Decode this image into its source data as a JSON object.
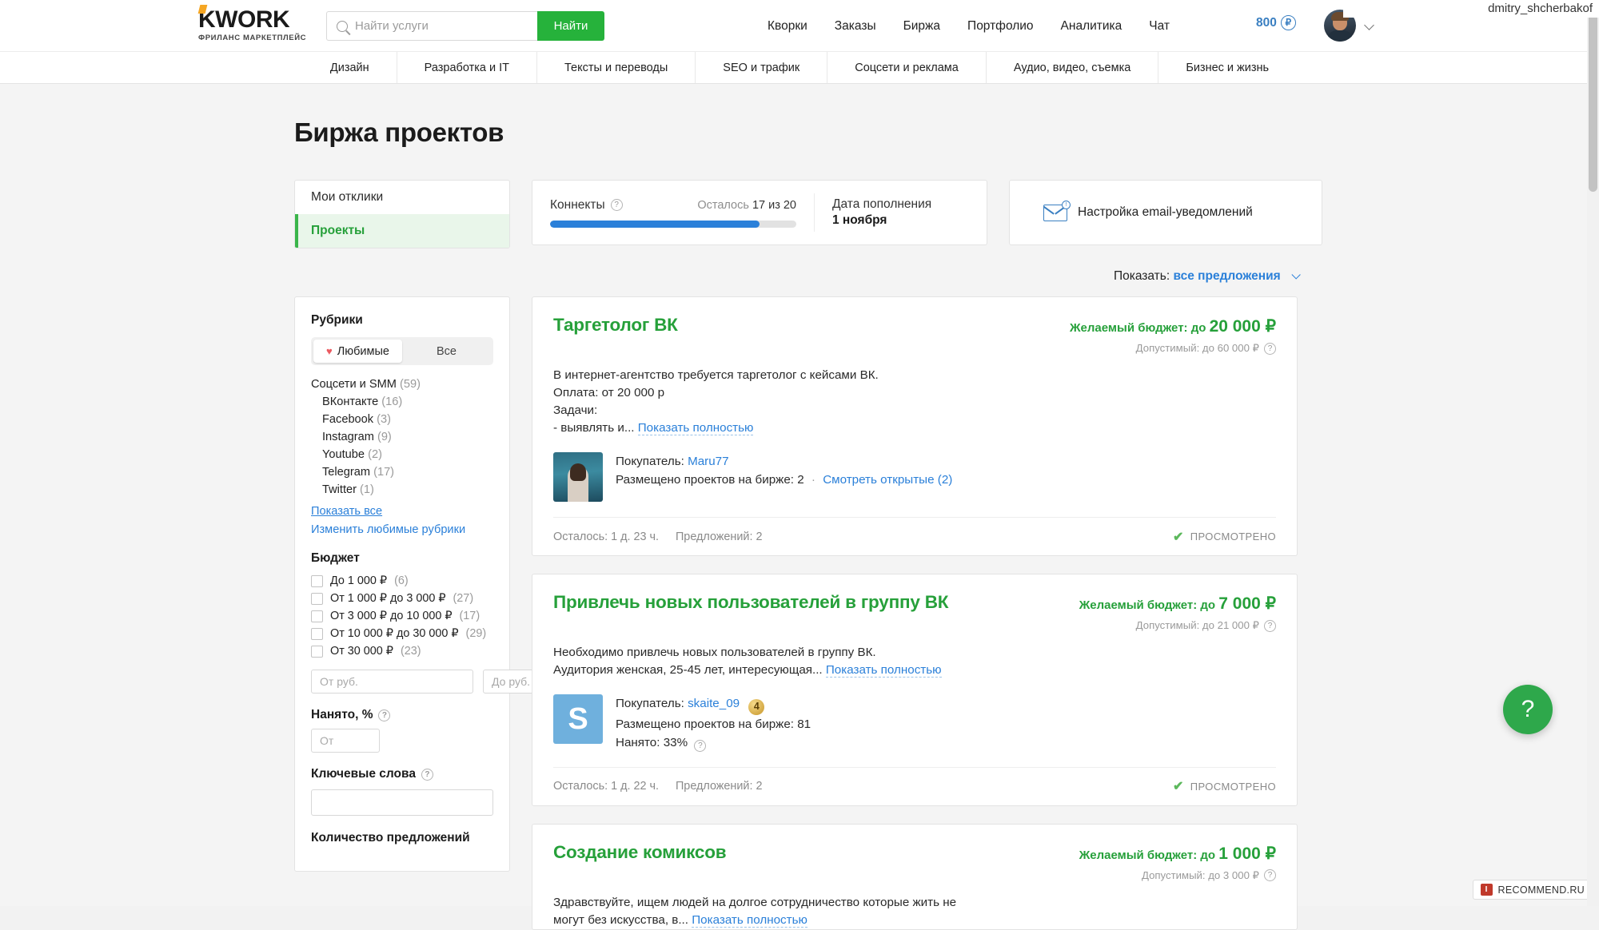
{
  "account": {
    "username": "dmitry_shcherbakof"
  },
  "header": {
    "logo": {
      "main": "KWORK",
      "sub": "ФРИЛАНС МАРКЕТПЛЕЙС"
    },
    "search": {
      "placeholder": "Найти услуги",
      "value": "",
      "button": "Найти",
      "icon": "search-icon"
    },
    "nav": [
      {
        "label": "Кворки"
      },
      {
        "label": "Заказы"
      },
      {
        "label": "Биржа"
      },
      {
        "label": "Портфолио"
      },
      {
        "label": "Аналитика"
      },
      {
        "label": "Чат"
      }
    ],
    "balance": {
      "amount": "800",
      "currency": "₽"
    }
  },
  "categories": [
    {
      "label": "Дизайн"
    },
    {
      "label": "Разработка и IT"
    },
    {
      "label": "Тексты и переводы"
    },
    {
      "label": "SEO и трафик"
    },
    {
      "label": "Соцсети и реклама"
    },
    {
      "label": "Аудио, видео, съемка"
    },
    {
      "label": "Бизнес и жизнь"
    }
  ],
  "page": {
    "title": "Биржа проектов"
  },
  "tabs": [
    {
      "label": "Мои отклики",
      "active": false
    },
    {
      "label": "Проекты",
      "active": true
    }
  ],
  "connects": {
    "label": "Коннекты",
    "remaining_text": "Осталось",
    "remaining_value": "17 из 20",
    "progress_percent": 85,
    "refill_label": "Дата пополнения",
    "refill_date": "1 ноября"
  },
  "email_settings": {
    "label": "Настройка email-уведомлений",
    "icon": "envelope-icon"
  },
  "show_filter": {
    "prefix": "Показать:",
    "value": "все предложения"
  },
  "filters": {
    "rubrics": {
      "title": "Рубрики",
      "segments": [
        {
          "label": "Любимые",
          "active": true,
          "icon": "heart-icon"
        },
        {
          "label": "Все",
          "active": false
        }
      ],
      "parent": {
        "label": "Соцсети и SMM",
        "count": "(59)"
      },
      "children": [
        {
          "label": "ВКонтакте",
          "count": "(16)"
        },
        {
          "label": "Facebook",
          "count": "(3)"
        },
        {
          "label": "Instagram",
          "count": "(9)"
        },
        {
          "label": "Youtube",
          "count": "(2)"
        },
        {
          "label": "Telegram",
          "count": "(17)"
        },
        {
          "label": "Twitter",
          "count": "(1)"
        }
      ],
      "show_all": "Показать все",
      "edit_favorites": "Изменить любимые рубрики"
    },
    "budget": {
      "title": "Бюджет",
      "options": [
        {
          "label": "До 1 000 ₽",
          "count": "(6)"
        },
        {
          "label": "От 1 000 ₽ до 3 000 ₽",
          "count": "(27)"
        },
        {
          "label": "От 3 000 ₽ до 10 000 ₽",
          "count": "(17)"
        },
        {
          "label": "От 10 000 ₽ до 30 000 ₽",
          "count": "(29)"
        },
        {
          "label": "От 30 000 ₽",
          "count": "(23)"
        }
      ],
      "from_placeholder": "От руб.",
      "to_placeholder": "До руб."
    },
    "hired": {
      "title": "Нанято, %",
      "placeholder": "От"
    },
    "keywords": {
      "title": "Ключевые слова",
      "placeholder": ""
    },
    "offers_count": {
      "title": "Количество предложений"
    }
  },
  "projects": [
    {
      "title": "Таргетолог ВК",
      "description_lines": [
        "В интернет-агентство требуется таргетолог с кейсами ВК.",
        "Оплата: от 20 000 р",
        "Задачи:",
        "- выявлять и..."
      ],
      "more_label": "Показать полностью",
      "budget_prefix": "Желаемый бюджет: до",
      "budget_amount": "20 000 ₽",
      "allowed": "Допустимый: до 60 000 ₽",
      "buyer_label": "Покупатель:",
      "buyer_name": "Maru77",
      "buyer_level": "",
      "posted_label": "Размещено проектов на бирже: 2",
      "open_link": "Смотреть открытые (2)",
      "hired_text": "",
      "time_left": "Осталось: 1 д. 23 ч.",
      "offers": "Предложений: 2",
      "viewed": "ПРОСМОТРЕНО",
      "avatar_type": "photo",
      "avatar_letter": ""
    },
    {
      "title": "Привлечь новых пользователей в группу ВК",
      "description_lines": [
        "Необходимо привлечь новых пользователей в группу ВК.",
        "Аудитория женская, 25-45 лет, интересующая..."
      ],
      "more_label": "Показать полностью",
      "budget_prefix": "Желаемый бюджет: до",
      "budget_amount": "7 000 ₽",
      "allowed": "Допустимый: до 21 000 ₽",
      "buyer_label": "Покупатель:",
      "buyer_name": "skaite_09",
      "buyer_level": "4",
      "posted_label": "Размещено проектов на бирже: 81",
      "open_link": "",
      "hired_text": "Нанято: 33%",
      "time_left": "Осталось: 1 д. 22 ч.",
      "offers": "Предложений: 2",
      "viewed": "ПРОСМОТРЕНО",
      "avatar_type": "letter",
      "avatar_letter": "S"
    },
    {
      "title": "Создание комиксов",
      "description_lines": [
        "Здравствуйте, ищем людей на долгое сотрудничество которые жить не",
        "могут без искусства, в..."
      ],
      "more_label": "Показать полностью",
      "budget_prefix": "Желаемый бюджет: до",
      "budget_amount": "1 000 ₽",
      "allowed": "Допустимый: до 3 000 ₽",
      "buyer_label": "",
      "buyer_name": "",
      "buyer_level": "",
      "posted_label": "",
      "open_link": "",
      "hired_text": "",
      "time_left": "",
      "offers": "",
      "viewed": "",
      "avatar_type": "none",
      "avatar_letter": ""
    }
  ],
  "help_button": {
    "label": "?"
  },
  "watermark": {
    "text": "RECOMMEND.RU",
    "mark": "I"
  }
}
